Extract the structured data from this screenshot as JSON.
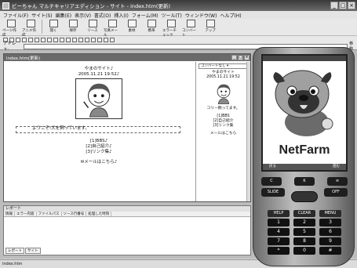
{
  "window": {
    "title": "ビーちゃん マルチキャリアエディション - サイト - index.htm(更新)"
  },
  "menu": [
    "ファイル(F)",
    "サイト(S)",
    "編集(E)",
    "表示(V)",
    "書式(O)",
    "挿入(I)",
    "フォーム(M)",
    "ツール(T)",
    "ウィンドウ(W)",
    "ヘルプ(H)"
  ],
  "toolbar": [
    "ページ作成",
    "アニメ作成",
    "開く",
    "保存",
    "ソース",
    "写真メール",
    "素材",
    "携帯",
    "エラーチェック",
    "コンバート",
    "アップ"
  ],
  "address": {
    "label": "アドレス:",
    "value": "",
    "go": "移動"
  },
  "doc": {
    "title": "index.htm(更新)",
    "site_name": "やまのサイト♪",
    "date": "2005.11.21 19:52♪",
    "marquee": "ようこそ!犬を飼っています。",
    "links": [
      "[1]BBS♪",
      "[2]自己紹介♪",
      "[3]リンク集♪"
    ],
    "mail": "メールはこちら♪"
  },
  "preview": {
    "select": "コンバートなし",
    "site_name": "やまのサイト",
    "date": "2005.11.21 19:52",
    "marquee": "コリー飼ってます。",
    "links": [
      "[1]BBS",
      "[2]自己紹介",
      "[3]リンク集"
    ],
    "mail": "メールはこちら"
  },
  "report": {
    "title": "レポート",
    "columns": [
      "情報",
      "エラー内容",
      "ファイルパス",
      "ソース行番号",
      "処理した時刻"
    ],
    "tabs": [
      "レポート",
      "サイト"
    ]
  },
  "statusbar": "index.htm",
  "phone": {
    "brand": "NetFarm",
    "soft_left": "戻る",
    "soft_right": "進む",
    "keys_top": [
      "C",
      "K",
      "≡"
    ],
    "keys_fn": [
      "SLIDE",
      "OFF"
    ],
    "keys_labels": [
      "HELP",
      "CLEAR",
      "MENU"
    ],
    "numpad": [
      "1",
      "2",
      "3",
      "4",
      "5",
      "6",
      "7",
      "8",
      "9",
      "*",
      "0",
      "#"
    ]
  }
}
